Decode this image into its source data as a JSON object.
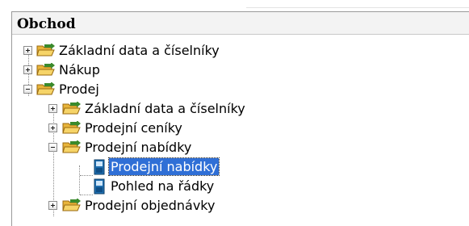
{
  "panel": {
    "title": "Obchod"
  },
  "tree": {
    "items": [
      {
        "label": "Základní data a číselníky",
        "state": "collapsed"
      },
      {
        "label": "Nákup",
        "state": "collapsed"
      },
      {
        "label": "Prodej",
        "state": "expanded",
        "children": [
          {
            "label": "Základní data a číselníky",
            "state": "collapsed"
          },
          {
            "label": "Prodejní ceníky",
            "state": "collapsed"
          },
          {
            "label": "Prodejní nabídky",
            "state": "expanded",
            "children": [
              {
                "label": "Prodejní nabídky",
                "selected": true
              },
              {
                "label": "Pohled na řádky",
                "selected": false
              }
            ]
          },
          {
            "label": "Prodejní objednávky",
            "state": "collapsed"
          }
        ]
      }
    ]
  },
  "icons": {
    "folder": "open-folder-icon",
    "document": "form-document-icon",
    "expand": "plus-box-icon",
    "collapse": "minus-box-icon"
  },
  "colors": {
    "selection_bg": "#2f6fd6",
    "selection_text": "#ffffff",
    "folder": "#e8b43a",
    "arrow": "#3a8a2c"
  }
}
